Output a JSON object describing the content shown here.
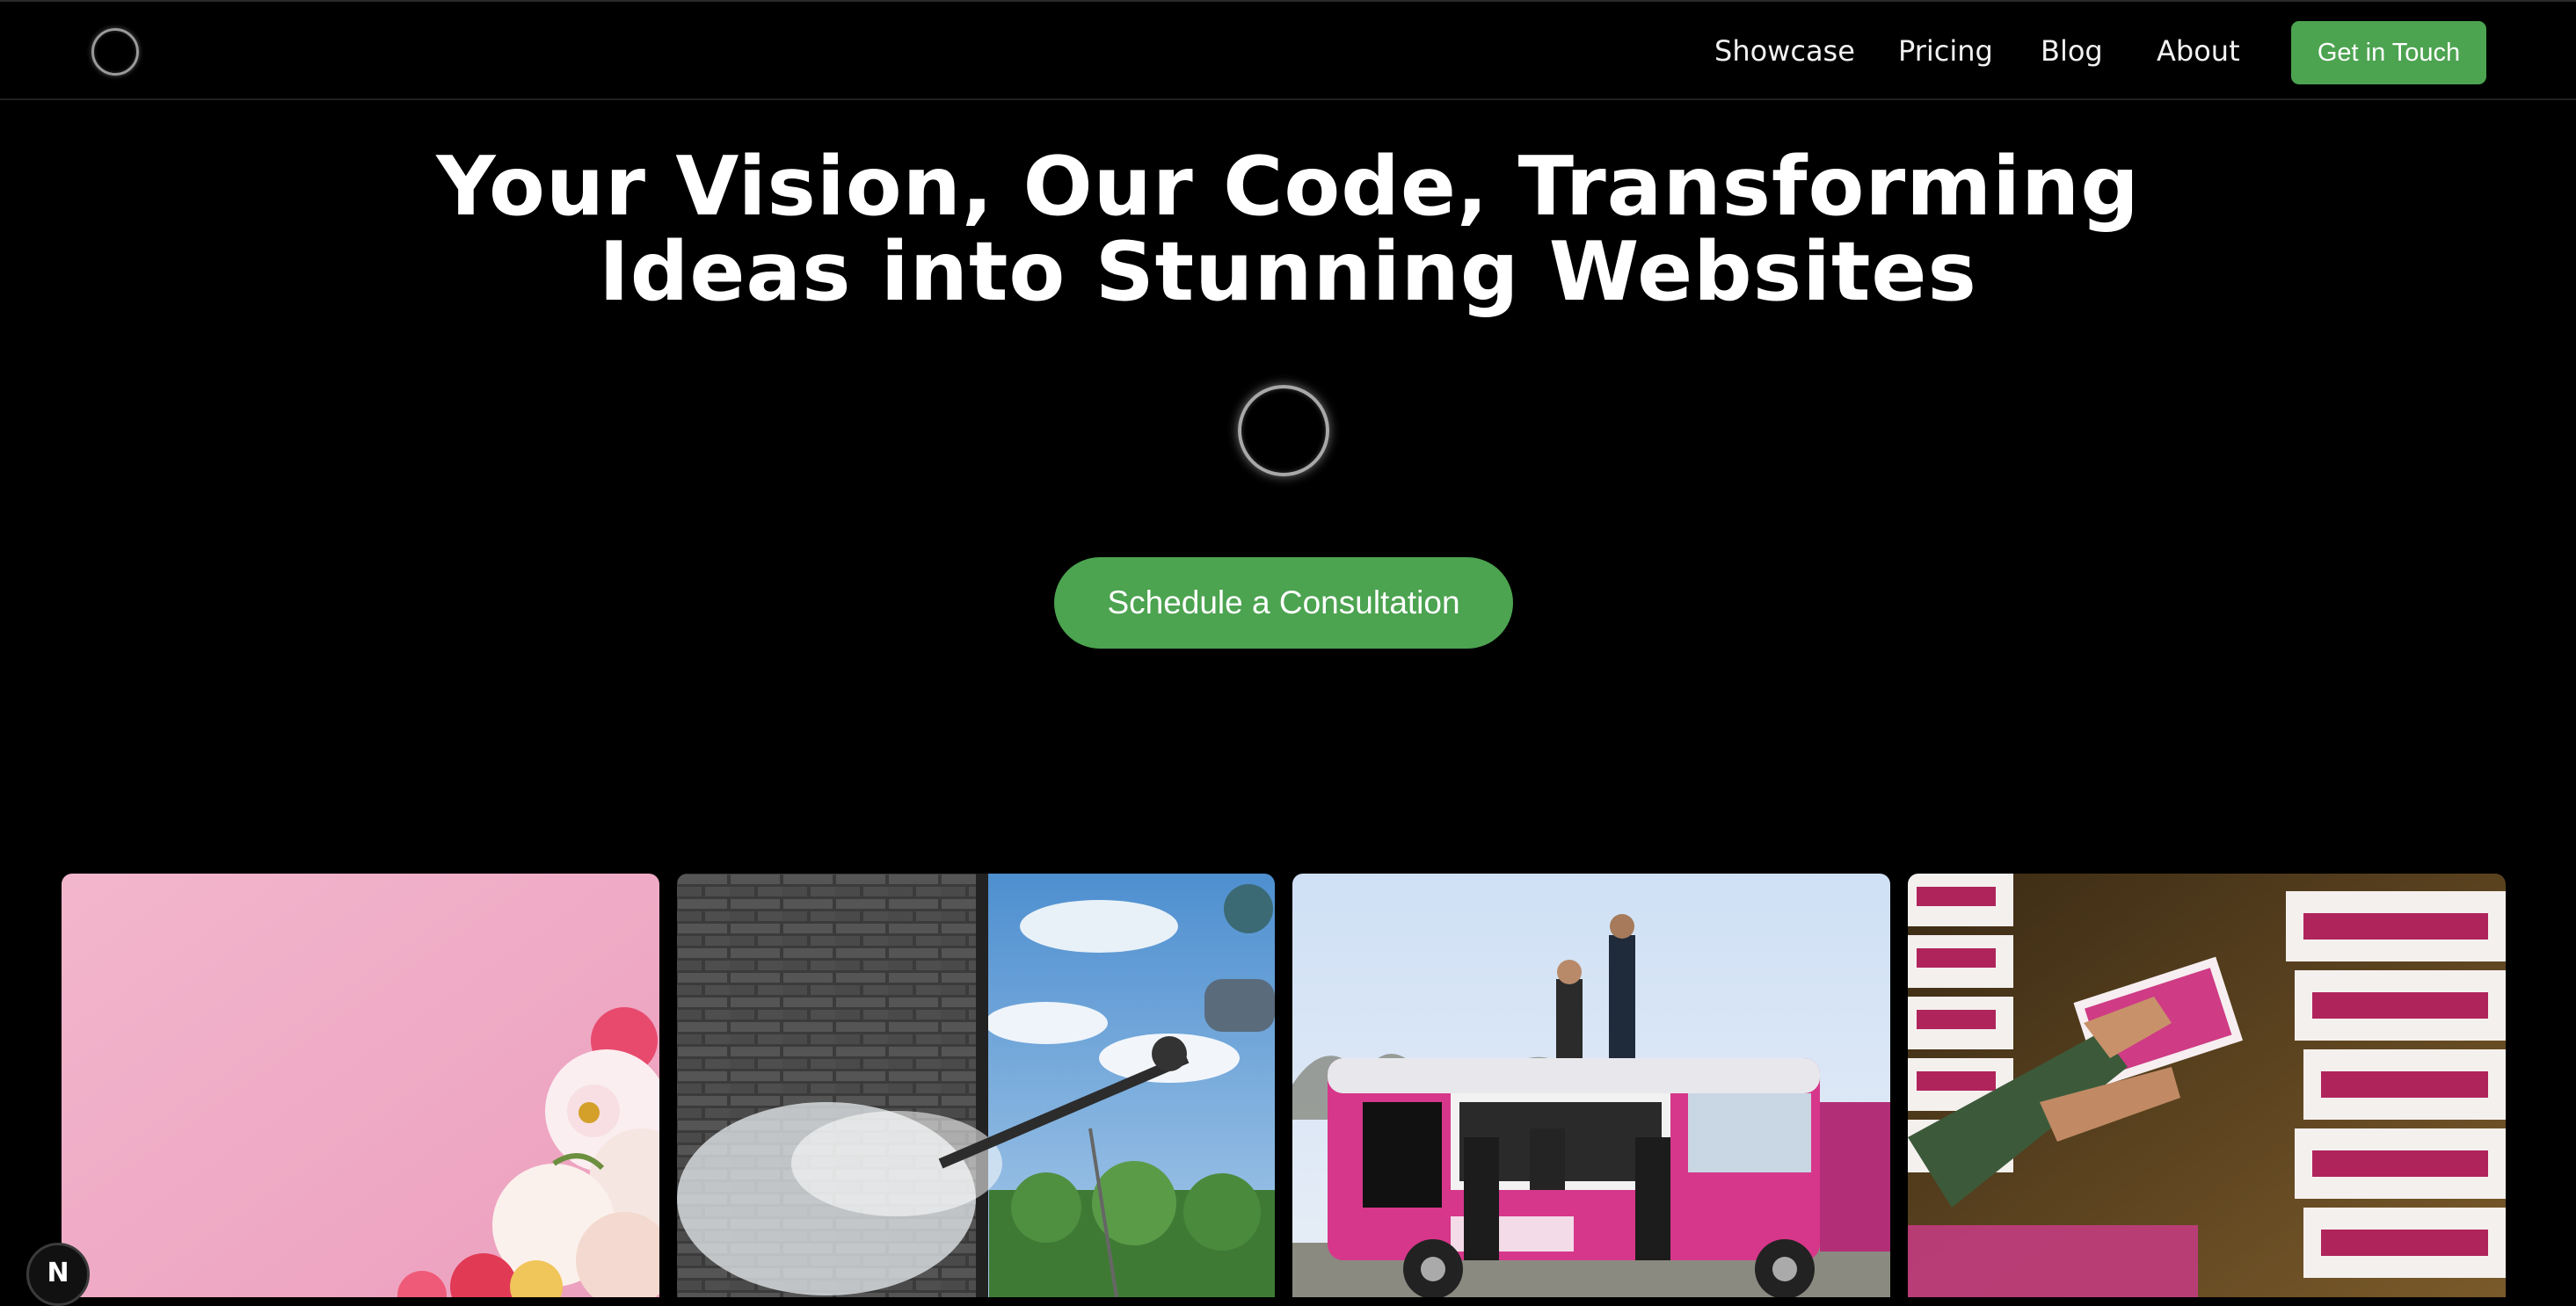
{
  "nav": {
    "links": [
      {
        "label": "Showcase"
      },
      {
        "label": "Pricing"
      },
      {
        "label": "Blog"
      },
      {
        "label": "About"
      }
    ],
    "cta_label": "Get in Touch"
  },
  "hero": {
    "title_line1": "Your Vision, Our Code, Transforming",
    "title_line2": "Ideas into Stunning Websites",
    "cta_label": "Schedule a Consultation"
  },
  "gallery": {
    "cards": [
      {
        "name": "pink-flowers-image"
      },
      {
        "name": "pressure-washing-image"
      },
      {
        "name": "pink-food-truck-image"
      },
      {
        "name": "taharka-boxes-image"
      }
    ]
  },
  "badge": {
    "letter": "N"
  },
  "colors": {
    "accent": "#4ca350",
    "background": "#000000",
    "text": "#ffffff"
  }
}
